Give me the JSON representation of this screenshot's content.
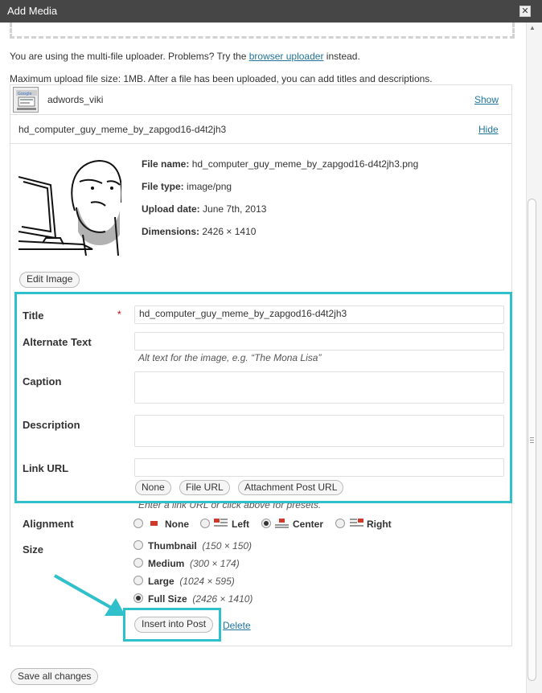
{
  "window": {
    "title": "Add Media",
    "close_glyph": "✕"
  },
  "notice": {
    "prefix": "You are using the multi-file uploader. Problems? Try the ",
    "link": "browser uploader",
    "suffix": " instead."
  },
  "max_upload": "Maximum upload file size: 1MB. After a file has been uploaded, you can add titles and descriptions.",
  "items": [
    {
      "filename": "adwords_viki",
      "toggle": "Show"
    },
    {
      "filename": "hd_computer_guy_meme_by_zapgod16-d4t2jh3",
      "toggle": "Hide"
    }
  ],
  "details": {
    "file_name_label": "File name:",
    "file_name": "hd_computer_guy_meme_by_zapgod16-d4t2jh3.png",
    "file_type_label": "File type:",
    "file_type": "image/png",
    "upload_date_label": "Upload date:",
    "upload_date": "June 7th, 2013",
    "dimensions_label": "Dimensions:",
    "dimensions": "2426 × 1410"
  },
  "edit_image_label": "Edit Image",
  "form": {
    "title_label": "Title",
    "required_mark": "*",
    "title_value": "hd_computer_guy_meme_by_zapgod16-d4t2jh3",
    "alt_label": "Alternate Text",
    "alt_value": "",
    "alt_help": "Alt text for the image, e.g. “The Mona Lisa”",
    "caption_label": "Caption",
    "caption_value": "",
    "description_label": "Description",
    "description_value": "",
    "link_label": "Link URL",
    "link_value": "",
    "link_buttons": [
      "None",
      "File URL",
      "Attachment Post URL"
    ],
    "link_help": "Enter a link URL or click above for presets."
  },
  "alignment": {
    "label": "Alignment",
    "options": [
      "None",
      "Left",
      "Center",
      "Right"
    ],
    "selected": "Center"
  },
  "size": {
    "label": "Size",
    "options": [
      {
        "name": "Thumbnail",
        "dims": "(150 × 150)"
      },
      {
        "name": "Medium",
        "dims": "(300 × 174)"
      },
      {
        "name": "Large",
        "dims": "(1024 × 595)"
      },
      {
        "name": "Full Size",
        "dims": "(2426 × 1410)"
      }
    ],
    "selected": "Full Size"
  },
  "actions": {
    "insert": "Insert into Post",
    "delete": "Delete",
    "save_all": "Save all changes"
  },
  "colors": {
    "highlight": "#30c0cb",
    "link": "#21759b",
    "titlebar": "#464646"
  }
}
